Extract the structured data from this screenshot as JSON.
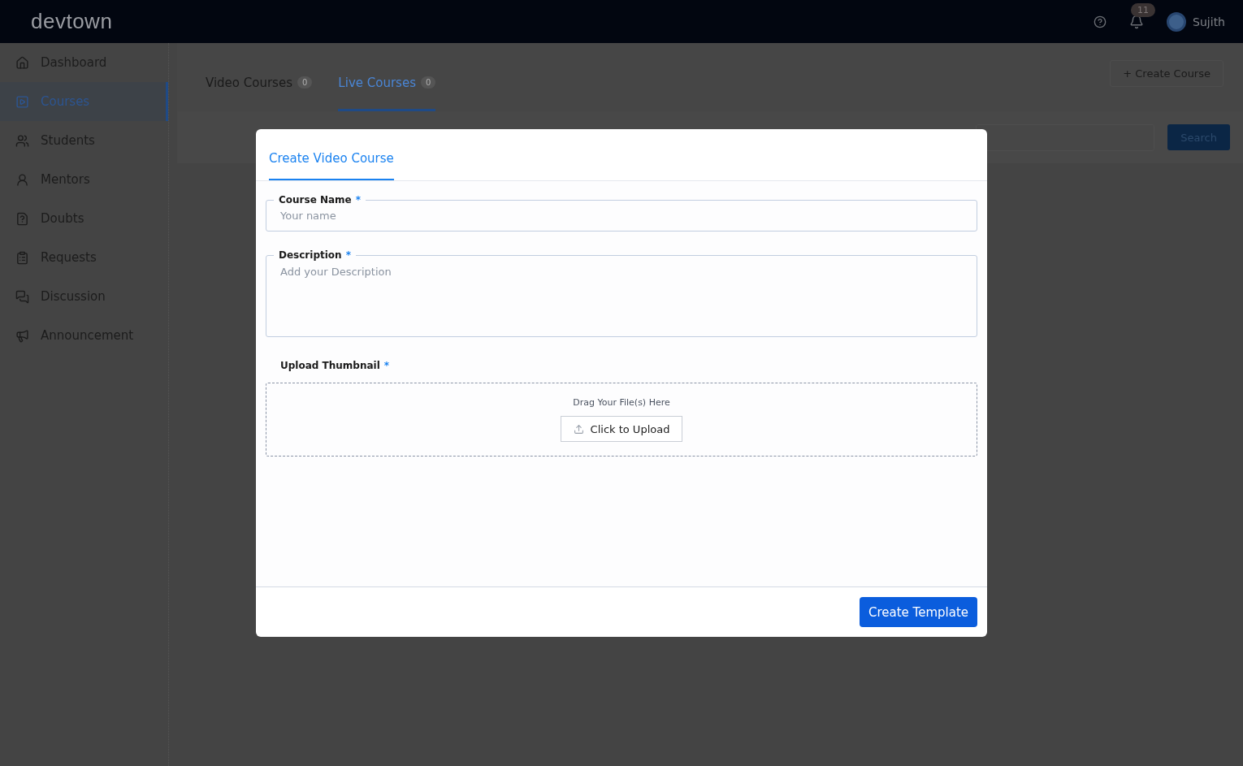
{
  "header": {
    "logo": "devtown",
    "notification_count": "11",
    "user_name": "Sujith"
  },
  "sidebar": {
    "items": [
      {
        "label": "Dashboard",
        "selected": false
      },
      {
        "label": "Courses",
        "selected": true
      },
      {
        "label": "Students",
        "selected": false
      },
      {
        "label": "Mentors",
        "selected": false
      },
      {
        "label": "Doubts",
        "selected": false
      },
      {
        "label": "Requests",
        "selected": false
      },
      {
        "label": "Discussion",
        "selected": false
      },
      {
        "label": "Announcement",
        "selected": false
      }
    ]
  },
  "tabs": [
    {
      "label": "Video Courses",
      "count": "0",
      "selected": false
    },
    {
      "label": "Live Courses",
      "count": "0",
      "selected": true
    }
  ],
  "create_course_button": "+ Create Course",
  "search": {
    "button": "Search"
  },
  "modal": {
    "tabs": [
      {
        "label": "Create Video Course",
        "selected": true
      }
    ],
    "fields": [
      {
        "kind": "input",
        "label": "Course Name",
        "required_mark": "*",
        "placeholder": "Your name"
      },
      {
        "kind": "textarea",
        "label": "Description",
        "required_mark": "*",
        "placeholder": "Add your Description"
      }
    ],
    "upload": {
      "label": "Upload Thumbnail",
      "required_mark": "*",
      "hint": "Drag Your File(s) Here",
      "button": "Click to Upload"
    },
    "submit": "Create Template"
  }
}
